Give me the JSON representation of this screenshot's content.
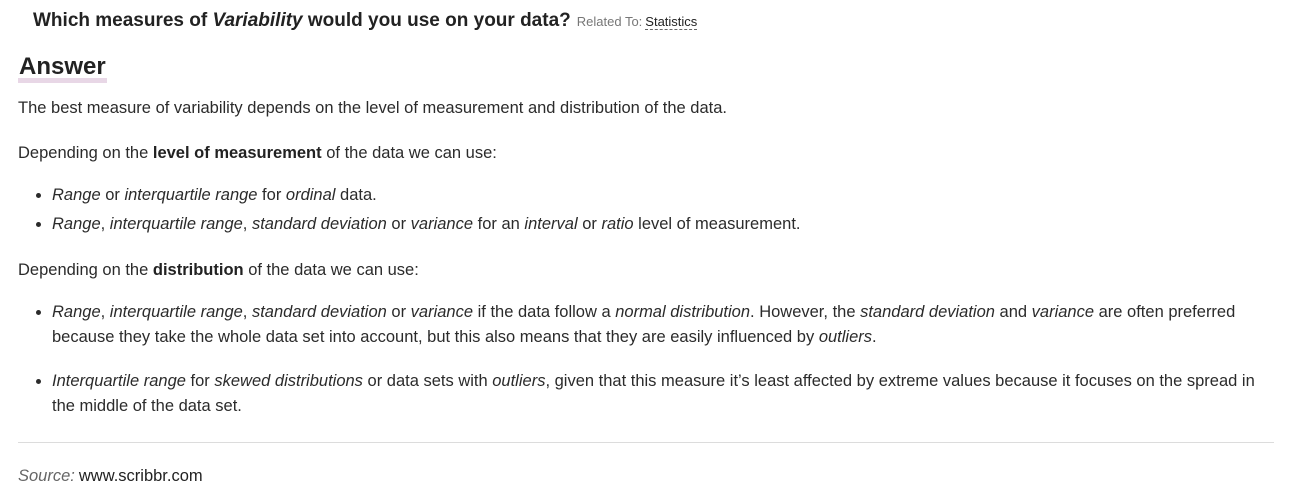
{
  "question": {
    "prefix": "Which measures of",
    "emphasis": "Variability",
    "suffix": "would you use on your data?",
    "related_label": "Related To:",
    "related_link": "Statistics"
  },
  "answer": {
    "heading": "Answer",
    "intro": "The best measure of variability depends on the level of measurement and distribution of the data.",
    "level_section": {
      "lead_before": "Depending on the",
      "lead_bold": "level of measurement",
      "lead_after": "of the data we can use:",
      "items": [
        [
          {
            "t": "Range",
            "s": "i"
          },
          {
            "t": " or "
          },
          {
            "t": "interquartile range",
            "s": "i"
          },
          {
            "t": " for "
          },
          {
            "t": "ordinal",
            "s": "i"
          },
          {
            "t": " data."
          }
        ],
        [
          {
            "t": "Range",
            "s": "i"
          },
          {
            "t": ", "
          },
          {
            "t": "interquartile range",
            "s": "i"
          },
          {
            "t": ", "
          },
          {
            "t": "standard deviation",
            "s": "i"
          },
          {
            "t": " or "
          },
          {
            "t": "variance",
            "s": "i"
          },
          {
            "t": " for an "
          },
          {
            "t": "interval",
            "s": "i"
          },
          {
            "t": " or "
          },
          {
            "t": "ratio",
            "s": "i"
          },
          {
            "t": " level of measurement."
          }
        ]
      ]
    },
    "distribution_section": {
      "lead_before": "Depending on the",
      "lead_bold": "distribution",
      "lead_after": "of the data we can use:",
      "items": [
        [
          {
            "t": "Range",
            "s": "i"
          },
          {
            "t": ", "
          },
          {
            "t": "interquartile range",
            "s": "i"
          },
          {
            "t": ", "
          },
          {
            "t": "standard deviation",
            "s": "i"
          },
          {
            "t": " or "
          },
          {
            "t": "variance",
            "s": "i"
          },
          {
            "t": " if the data follow a "
          },
          {
            "t": "normal distribution",
            "s": "i"
          },
          {
            "t": ". However, the "
          },
          {
            "t": "standard deviation",
            "s": "i"
          },
          {
            "t": " and "
          },
          {
            "t": "variance",
            "s": "i"
          },
          {
            "t": " are often preferred because they take the whole data set into account, but this also means that they are easily influenced by "
          },
          {
            "t": "outliers",
            "s": "i"
          },
          {
            "t": "."
          }
        ],
        [
          {
            "t": "Interquartile range",
            "s": "i"
          },
          {
            "t": " for "
          },
          {
            "t": "skewed distributions",
            "s": "i"
          },
          {
            "t": " or data sets with "
          },
          {
            "t": "outliers",
            "s": "i"
          },
          {
            "t": ", given that this measure it’s least affected by extreme values because it focuses on the spread in the middle of the data set."
          }
        ]
      ]
    }
  },
  "source": {
    "label": "Source:",
    "value": "www.scribbr.com"
  }
}
